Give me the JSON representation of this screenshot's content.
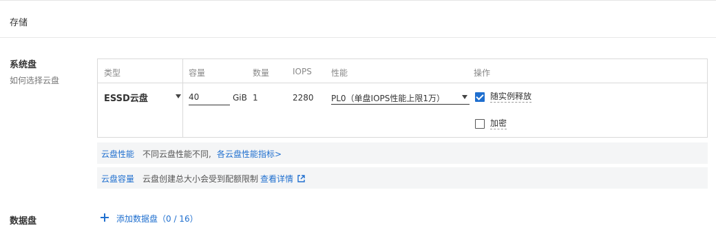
{
  "section": {
    "title": "存储"
  },
  "system_disk": {
    "label": "系统盘",
    "help_link": "如何选择云盘",
    "table": {
      "headers": [
        "类型",
        "容量",
        "数量",
        "IOPS",
        "性能",
        "操作"
      ],
      "row": {
        "type": "ESSD云盘",
        "capacity": "40",
        "capacity_unit": "GiB",
        "quantity": "1",
        "iops": "2280",
        "performance": "PL0（单盘IOPS性能上限1万）",
        "release_with_instance": {
          "label": "随实例释放",
          "checked": true
        },
        "encryption": {
          "label": "加密",
          "checked": false
        }
      }
    },
    "info_performance": {
      "tag": "云盘性能",
      "text": "不同云盘性能不同,",
      "link": "各云盘性能指标>"
    },
    "info_capacity": {
      "tag": "云盘容量",
      "text": "云盘创建总大小会受到配额限制",
      "link": "查看详情"
    }
  },
  "data_disk": {
    "label": "数据盘",
    "add_label": "添加数据盘（0 / 16）"
  },
  "colors": {
    "accent": "#1f6fcf",
    "checkbox_checked": "#1f6fcf",
    "info_bg": "#f4f5f6"
  },
  "icons": [
    "chevron-down-icon",
    "check-icon",
    "external-link-icon",
    "plus-icon"
  ]
}
